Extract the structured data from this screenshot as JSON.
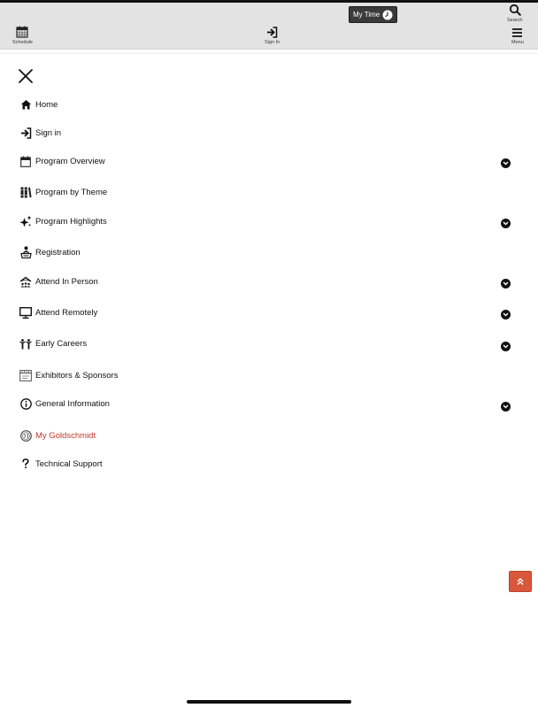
{
  "header": {
    "my_time_label": "My Time",
    "search_label": "Search",
    "schedule_label": "Schedule",
    "sign_in_label": "Sign In",
    "menu_label": "Menu"
  },
  "menu": {
    "items": [
      {
        "label": "Home",
        "icon": "home-icon",
        "expandable": false
      },
      {
        "label": "Sign in",
        "icon": "sign-in-icon",
        "expandable": false
      },
      {
        "label": "Program Overview",
        "icon": "calendar-icon",
        "expandable": true
      },
      {
        "label": "Program by Theme",
        "icon": "theme-grid-icon",
        "expandable": false
      },
      {
        "label": "Program Highlights",
        "icon": "sparkles-icon",
        "expandable": true
      },
      {
        "label": "Registration",
        "icon": "registration-icon",
        "expandable": false
      },
      {
        "label": "Attend In Person",
        "icon": "venue-icon",
        "expandable": true
      },
      {
        "label": "Attend Remotely",
        "icon": "monitor-icon",
        "expandable": true
      },
      {
        "label": "Early Careers",
        "icon": "people-icon",
        "expandable": true
      },
      {
        "label": "Exhibitors & Sponsors",
        "icon": "exhibitors-icon",
        "expandable": false
      },
      {
        "label": "General Information",
        "icon": "info-icon",
        "expandable": true
      },
      {
        "label": "My Goldschmidt",
        "icon": "globe-icon",
        "expandable": false,
        "accent": true
      },
      {
        "label": "Technical Support",
        "icon": "question-icon",
        "expandable": false
      }
    ]
  },
  "colors": {
    "accent": "#c0392b",
    "to_top_button": "#d9573b",
    "header_bg": "#e3e3e3"
  }
}
